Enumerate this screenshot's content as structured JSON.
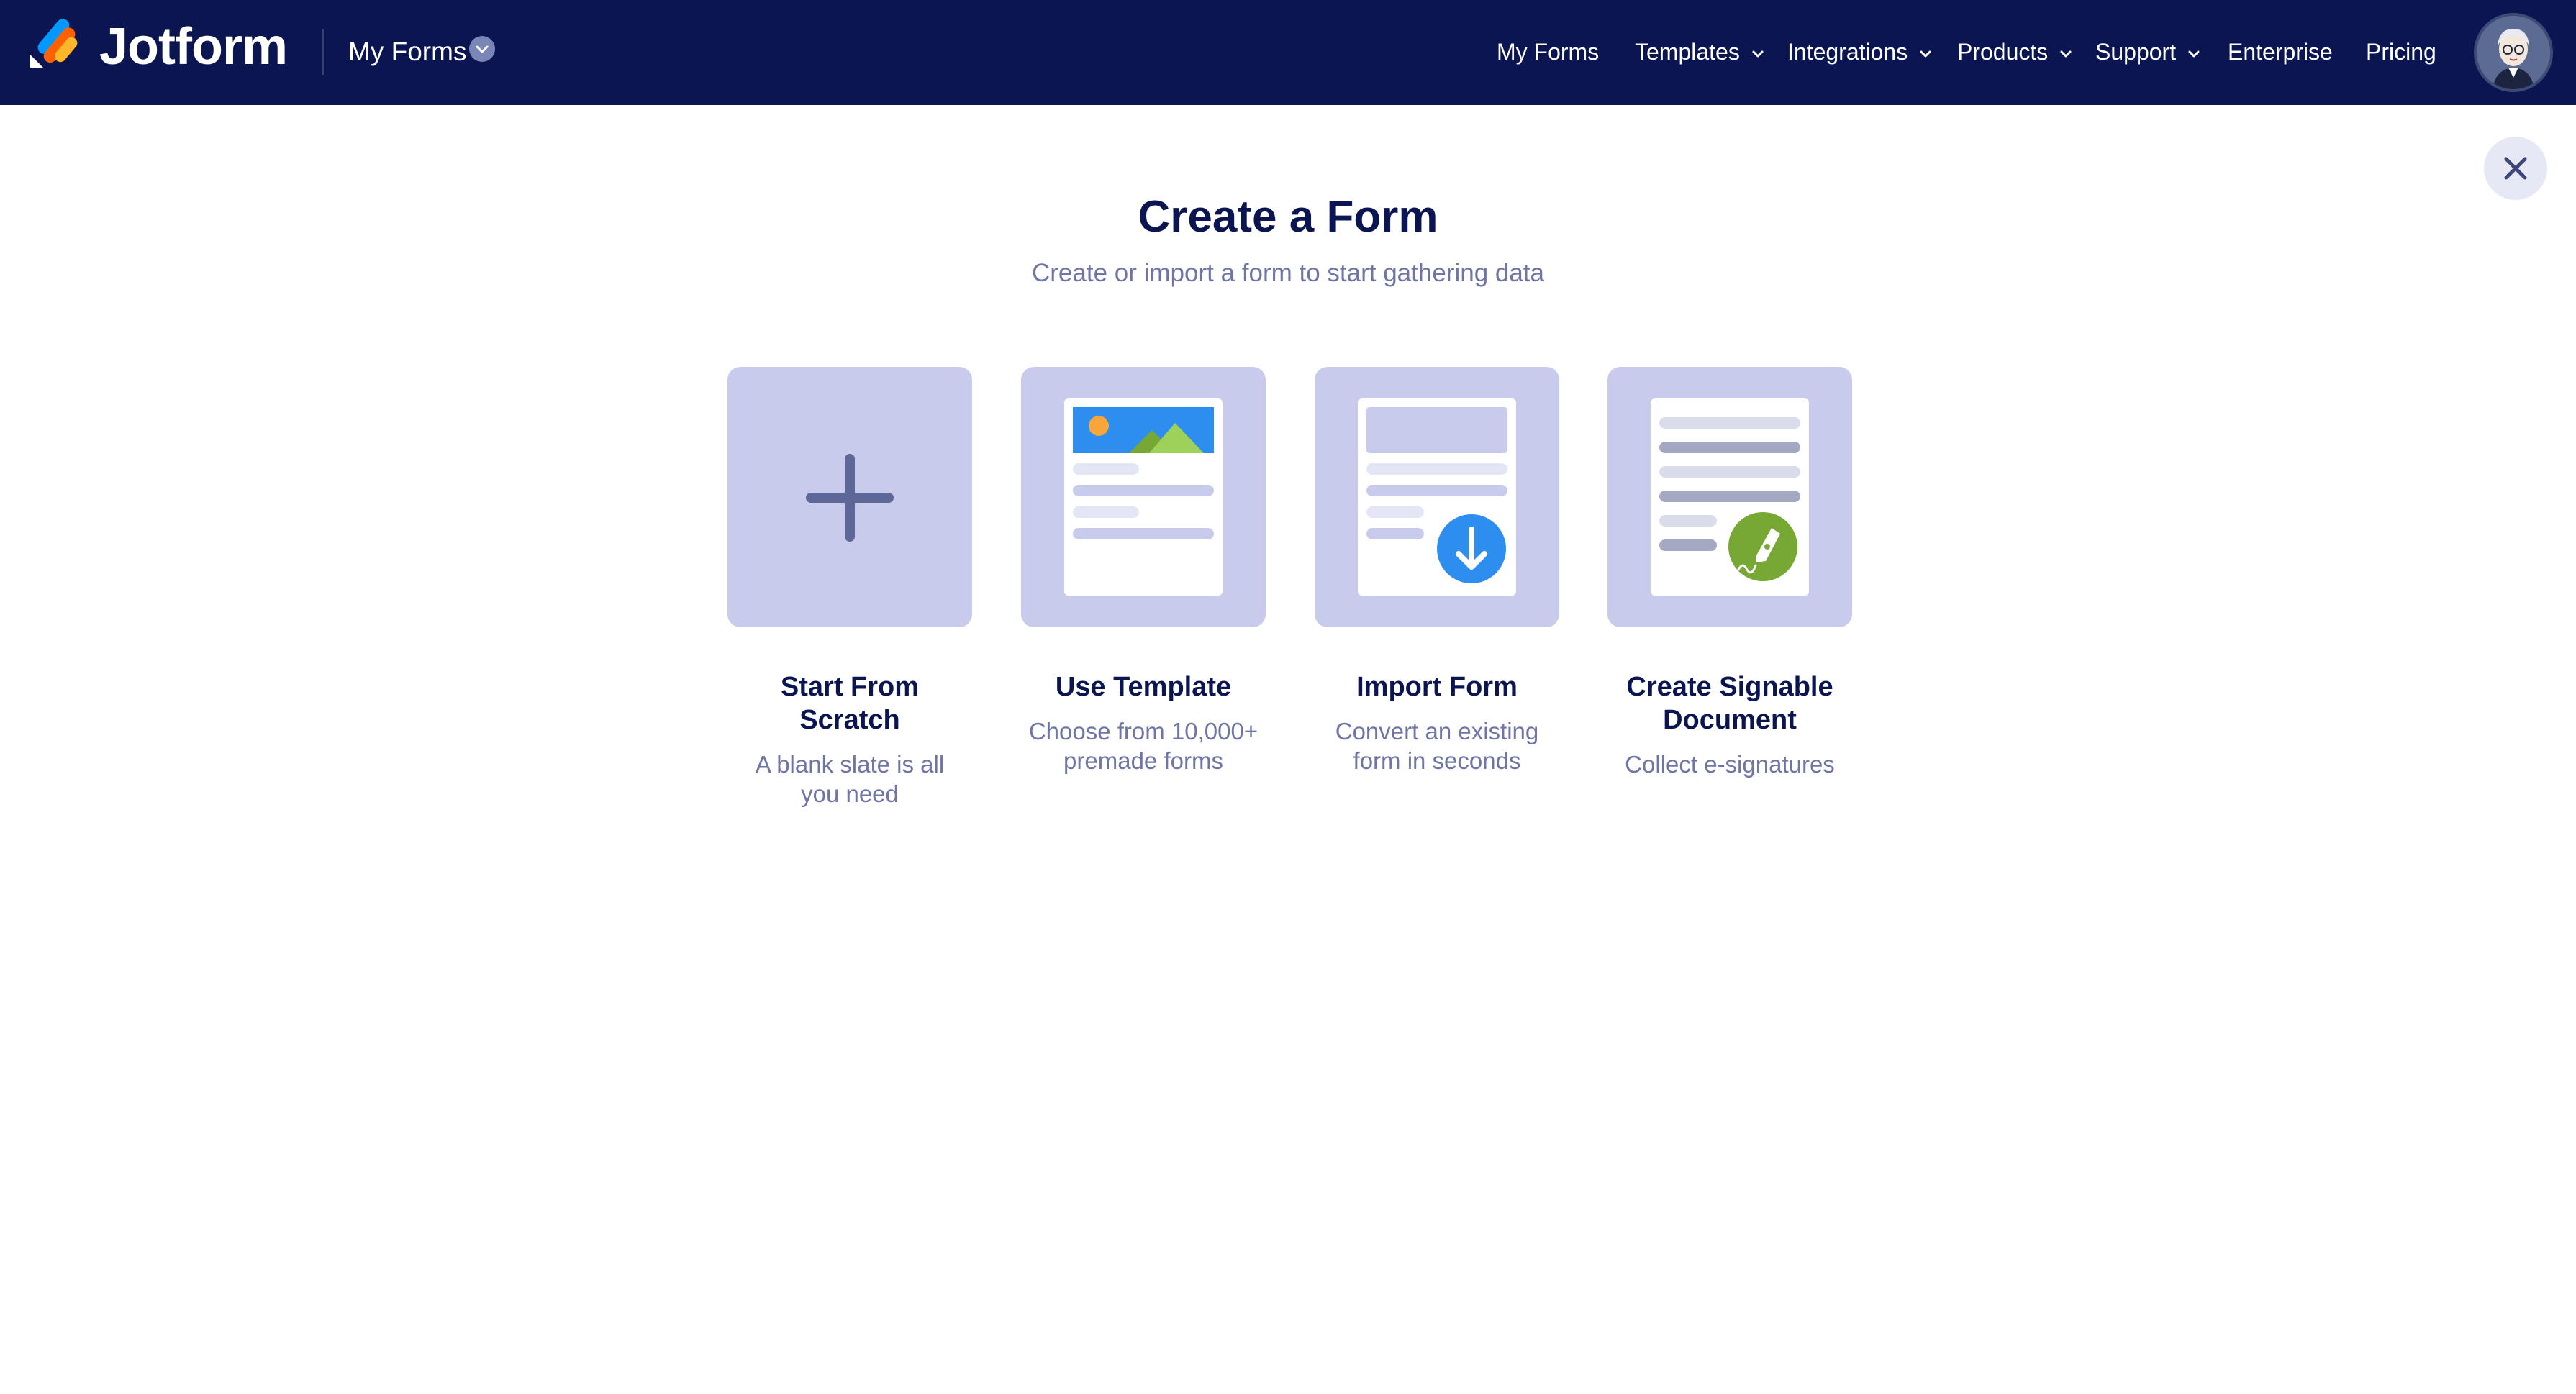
{
  "header": {
    "brand": "Jotform",
    "section_label": "My Forms",
    "nav": [
      {
        "label": "My Forms",
        "has_dropdown": false
      },
      {
        "label": "Templates",
        "has_dropdown": true
      },
      {
        "label": "Integrations",
        "has_dropdown": true
      },
      {
        "label": "Products",
        "has_dropdown": true
      },
      {
        "label": "Support",
        "has_dropdown": true
      },
      {
        "label": "Enterprise",
        "has_dropdown": false
      },
      {
        "label": "Pricing",
        "has_dropdown": false
      }
    ],
    "avatar_icon": "user-avatar-icon"
  },
  "dialog": {
    "title": "Create a Form",
    "subtitle": "Create or import a form to start gathering data",
    "close_icon": "close-icon",
    "options": [
      {
        "title": "Start From Scratch",
        "description": "A blank slate is all you need",
        "icon": "plus-icon"
      },
      {
        "title": "Use Template",
        "description": "Choose from 10,000+ premade forms",
        "icon": "template-document-icon"
      },
      {
        "title": "Import Form",
        "description": "Convert an existing form in seconds",
        "icon": "import-document-icon"
      },
      {
        "title": "Create Signable Document",
        "description": "Collect e-signatures",
        "icon": "sign-document-icon"
      }
    ]
  },
  "colors": {
    "header_bg": "#0a1551",
    "tile_bg": "#c8cbeb",
    "title_text": "#0a1551",
    "muted_text": "#6f76a7",
    "import_accent": "#2e8ef0",
    "sign_accent": "#78a834"
  }
}
